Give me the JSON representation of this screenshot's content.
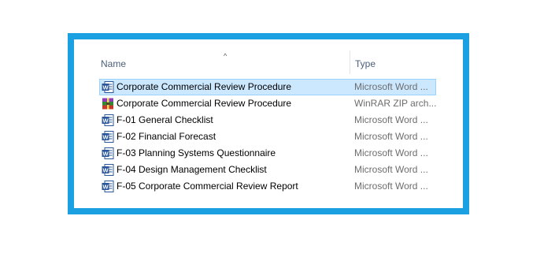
{
  "columns": {
    "name": "Name",
    "type": "Type",
    "sort_indicator": "^"
  },
  "files": [
    {
      "name": "Corporate Commercial Review Procedure",
      "type": "Microsoft Word ...",
      "icon": "word-doc-icon",
      "selected": true
    },
    {
      "name": "Corporate Commercial Review Procedure",
      "type": "WinRAR ZIP arch...",
      "icon": "winrar-archive-icon",
      "selected": false
    },
    {
      "name": "F-01 General Checklist",
      "type": "Microsoft Word ...",
      "icon": "word-doc-icon",
      "selected": false
    },
    {
      "name": "F-02 Financial Forecast",
      "type": "Microsoft Word ...",
      "icon": "word-doc-icon",
      "selected": false
    },
    {
      "name": "F-03 Planning Systems Questionnaire",
      "type": "Microsoft Word ...",
      "icon": "word-doc-icon",
      "selected": false
    },
    {
      "name": "F-04 Design Management Checklist",
      "type": "Microsoft Word ...",
      "icon": "word-doc-icon",
      "selected": false
    },
    {
      "name": "F-05 Corporate Commercial Review Report",
      "type": "Microsoft Word ...",
      "icon": "word-doc-icon",
      "selected": false
    }
  ],
  "colors": {
    "frame_border": "#1ba1e2",
    "selection_bg": "#cce8ff",
    "selection_border": "#99d1ff",
    "word_blue": "#2b579a"
  }
}
